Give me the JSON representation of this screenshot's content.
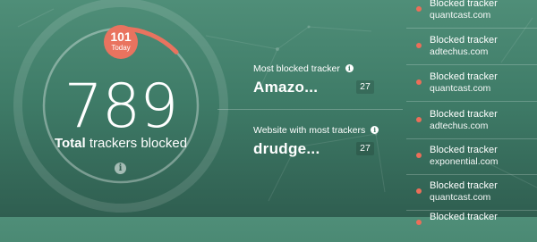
{
  "colors": {
    "accent_red": "#e9735f",
    "ring_track": "rgba(255,255,255,0.35)",
    "background_top": "#4f8e78",
    "background_bottom": "#2f5e50"
  },
  "summary": {
    "total_count": "789",
    "total_label_bold": "Total",
    "total_label_rest": " trackers blocked",
    "info_icon": "info-icon",
    "today_count": "101",
    "today_label": "Today",
    "progress_fraction": 0.128
  },
  "stats": {
    "most_blocked": {
      "label": "Most blocked tracker",
      "value": "Amazo...",
      "count": "27"
    },
    "most_trackers_site": {
      "label": "Website with most trackers",
      "value": "drudge...",
      "count": "27"
    }
  },
  "blocked_list": [
    {
      "title": "Blocked tracker",
      "domain": "quantcast.com"
    },
    {
      "title": "Blocked tracker",
      "domain": "adtechus.com"
    },
    {
      "title": "Blocked tracker",
      "domain": "quantcast.com"
    },
    {
      "title": "Blocked tracker",
      "domain": "adtechus.com"
    },
    {
      "title": "Blocked tracker",
      "domain": "exponential.com"
    },
    {
      "title": "Blocked tracker",
      "domain": "quantcast.com"
    },
    {
      "title": "Blocked tracker",
      "domain": ""
    }
  ]
}
